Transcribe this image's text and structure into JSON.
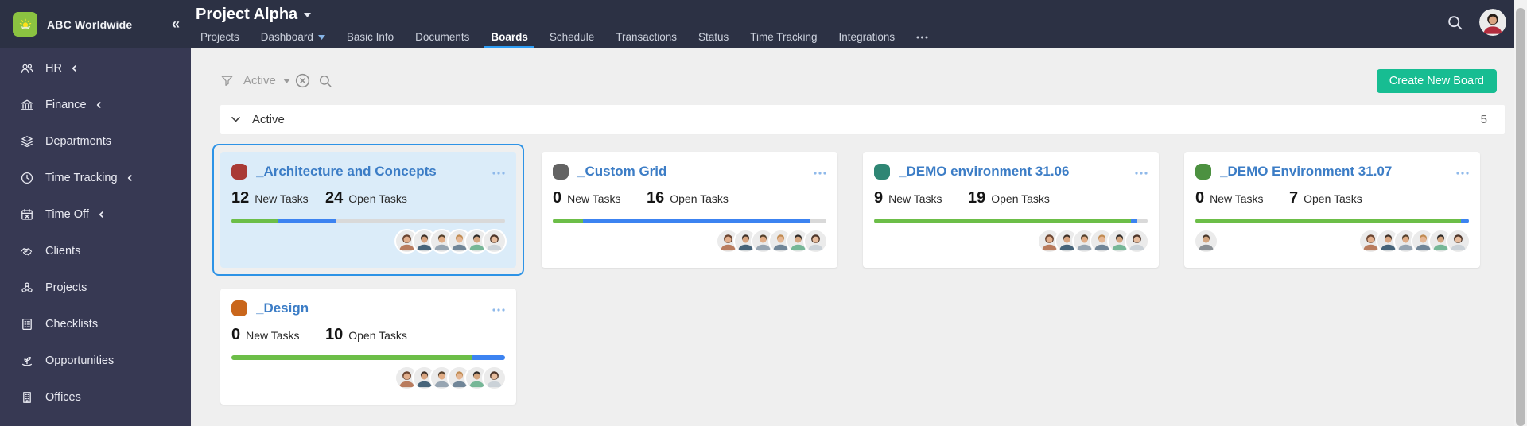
{
  "brand": {
    "company_name": "ABC Worldwide",
    "collapse_icon": "«"
  },
  "sidebar": {
    "items": [
      {
        "label": "HR",
        "icon": "people",
        "chevron": true
      },
      {
        "label": "Finance",
        "icon": "bank",
        "chevron": true
      },
      {
        "label": "Departments",
        "icon": "layers",
        "chevron": false
      },
      {
        "label": "Time Tracking",
        "icon": "clock",
        "chevron": true
      },
      {
        "label": "Time Off",
        "icon": "calendar-x",
        "chevron": true
      },
      {
        "label": "Clients",
        "icon": "handshake",
        "chevron": false
      },
      {
        "label": "Projects",
        "icon": "cluster",
        "chevron": false
      },
      {
        "label": "Checklists",
        "icon": "checklist",
        "chevron": false
      },
      {
        "label": "Opportunities",
        "icon": "seedling",
        "chevron": false
      },
      {
        "label": "Offices",
        "icon": "building",
        "chevron": false
      }
    ]
  },
  "header": {
    "project_title": "Project Alpha",
    "tabs": [
      {
        "label": "Projects"
      },
      {
        "label": "Dashboard",
        "has_caret": true
      },
      {
        "label": "Basic Info"
      },
      {
        "label": "Documents"
      },
      {
        "label": "Boards",
        "active": true
      },
      {
        "label": "Schedule"
      },
      {
        "label": "Transactions"
      },
      {
        "label": "Status"
      },
      {
        "label": "Time Tracking"
      },
      {
        "label": "Integrations"
      }
    ],
    "active_tab": "Boards"
  },
  "toolbar": {
    "filter_value": "Active",
    "create_board_label": "Create New Board"
  },
  "group_header": {
    "title": "Active",
    "count": "5"
  },
  "card_labels": {
    "new": "New Tasks",
    "open": "Open Tasks"
  },
  "boards": [
    {
      "title": "_Architecture and Concepts",
      "dot_color": "#a93a35",
      "new_tasks": "12",
      "open_tasks": "24",
      "progress_pct": {
        "green": 17,
        "blue": 21
      },
      "avatars": 6,
      "selected": true
    },
    {
      "title": "_Custom Grid",
      "dot_color": "#636363",
      "new_tasks": "0",
      "open_tasks": "16",
      "progress_pct": {
        "green": 11,
        "blue": 83
      },
      "avatars": 6,
      "selected": false
    },
    {
      "title": "_DEMO environment 31.06",
      "dot_color": "#2e8674",
      "new_tasks": "9",
      "open_tasks": "19",
      "progress_pct": {
        "green": 94,
        "blue": 2
      },
      "avatars": 6,
      "selected": false
    },
    {
      "title": "_DEMO Environment 31.07",
      "dot_color": "#4c9140",
      "new_tasks": "0",
      "open_tasks": "7",
      "progress_pct": {
        "green": 97,
        "blue": 3
      },
      "avatars": 6,
      "left_avatars": 1,
      "selected": false
    },
    {
      "title": "_Design",
      "dot_color": "#c9661b",
      "new_tasks": "0",
      "open_tasks": "10",
      "progress_pct": {
        "green": 88,
        "blue": 12
      },
      "avatars": 6,
      "selected": false
    }
  ],
  "colors": {
    "accent_tab_underline": "#2d9cf4",
    "create_button": "#17bd92",
    "progress_done": "#6cbe48",
    "progress_open": "#3c83f1",
    "selected_card_border": "#2e93e6",
    "selected_card_bg": "#dbecf9"
  }
}
